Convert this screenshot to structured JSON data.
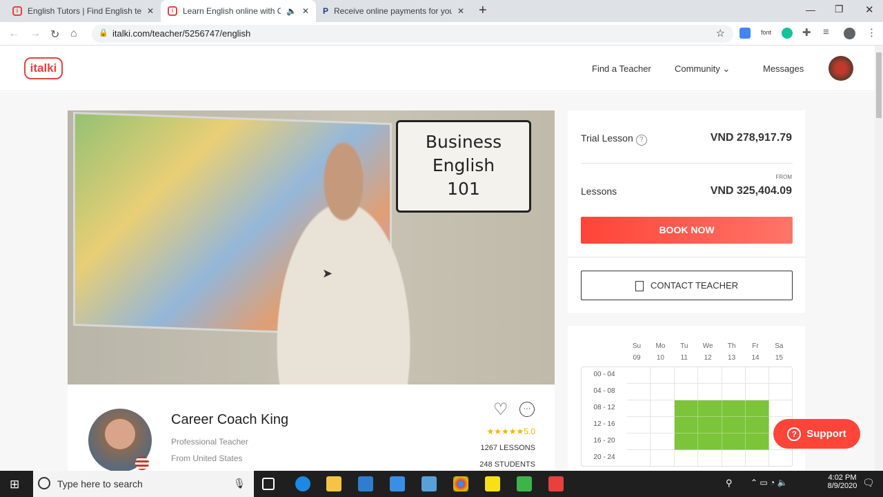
{
  "browser": {
    "tabs": [
      {
        "title": "English Tutors | Find English teac",
        "active": false
      },
      {
        "title": "Learn English online with Ca",
        "active": true
      },
      {
        "title": "Receive online payments for you",
        "active": false
      }
    ],
    "url": "italki.com/teacher/5256747/english",
    "ext_font": "font"
  },
  "header": {
    "logo": "italki",
    "nav": [
      "Find a Teacher",
      "Community",
      "Messages"
    ]
  },
  "video": {
    "whiteboard": [
      "Business",
      "English",
      "101"
    ]
  },
  "profile": {
    "name": "Career Coach King",
    "role": "Professional Teacher",
    "from": "From United States",
    "rating": "5.0",
    "stars": 5,
    "lessons": "1267 LESSONS",
    "students": "248 STUDENTS"
  },
  "pricing": {
    "trial_label": "Trial Lesson",
    "trial_price": "VND 278,917.79",
    "from_label": "FROM",
    "lessons_label": "Lessons",
    "lessons_price": "VND 325,404.09",
    "book": "BOOK NOW",
    "contact": "CONTACT TEACHER"
  },
  "calendar": {
    "days": [
      {
        "d": "Su",
        "n": "09"
      },
      {
        "d": "Mo",
        "n": "10"
      },
      {
        "d": "Tu",
        "n": "11"
      },
      {
        "d": "We",
        "n": "12"
      },
      {
        "d": "Th",
        "n": "13"
      },
      {
        "d": "Fr",
        "n": "14"
      },
      {
        "d": "Sa",
        "n": "15"
      }
    ],
    "slots": [
      "00 - 04",
      "04 - 08",
      "08 - 12",
      "12 - 16",
      "16 - 20",
      "20 - 24"
    ],
    "available": [
      [
        0,
        0,
        0,
        0,
        0,
        0,
        0
      ],
      [
        0,
        0,
        0,
        0,
        0,
        0,
        0
      ],
      [
        0,
        0,
        1,
        1,
        1,
        1,
        0
      ],
      [
        0,
        0,
        1,
        1,
        1,
        1,
        0
      ],
      [
        0,
        0,
        1,
        1,
        1,
        1,
        0
      ],
      [
        0,
        0,
        0,
        0,
        0,
        0,
        0
      ]
    ],
    "available_color": "#7cc43a"
  },
  "support": "Support",
  "taskbar": {
    "search_placeholder": "Type here to search",
    "time": "4:02 PM",
    "date": "8/9/2020"
  }
}
